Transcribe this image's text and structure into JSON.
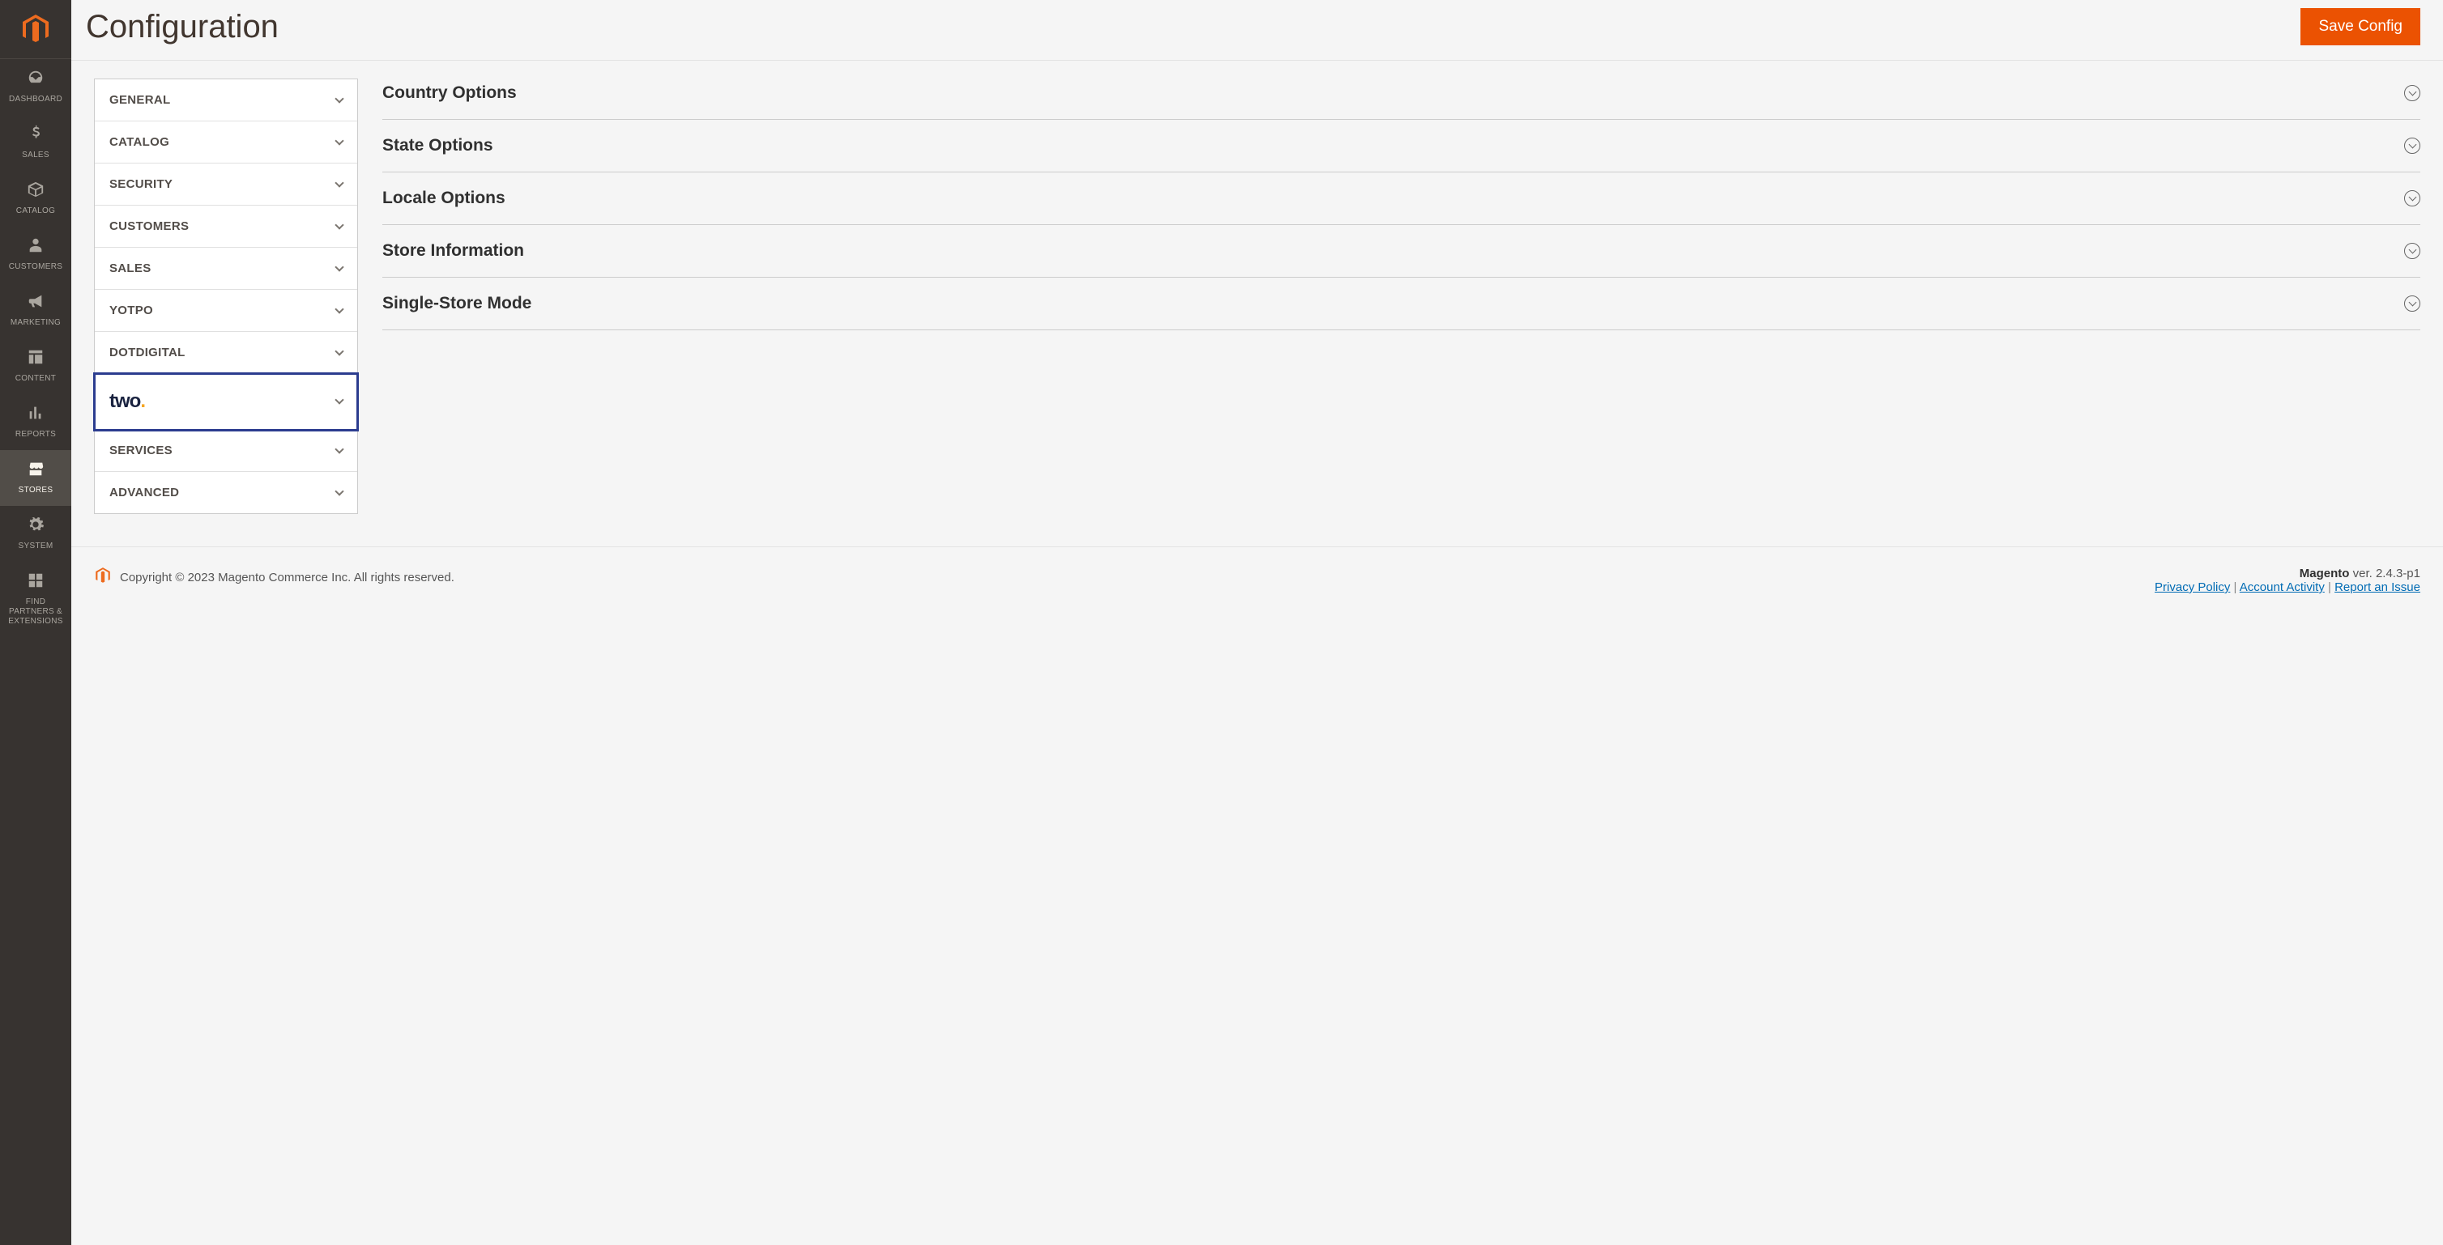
{
  "page": {
    "title": "Configuration",
    "save_label": "Save Config"
  },
  "nav": {
    "items": [
      {
        "key": "dashboard",
        "label": "DASHBOARD",
        "icon": "gauge"
      },
      {
        "key": "sales",
        "label": "SALES",
        "icon": "dollar"
      },
      {
        "key": "catalog",
        "label": "CATALOG",
        "icon": "box"
      },
      {
        "key": "customers",
        "label": "CUSTOMERS",
        "icon": "person"
      },
      {
        "key": "marketing",
        "label": "MARKETING",
        "icon": "megaphone"
      },
      {
        "key": "content",
        "label": "CONTENT",
        "icon": "layout"
      },
      {
        "key": "reports",
        "label": "REPORTS",
        "icon": "chart"
      },
      {
        "key": "stores",
        "label": "STORES",
        "icon": "store",
        "active": true
      },
      {
        "key": "system",
        "label": "SYSTEM",
        "icon": "gear"
      },
      {
        "key": "find_partners",
        "label": "FIND PARTNERS & EXTENSIONS",
        "icon": "blocks"
      }
    ]
  },
  "config_tabs": [
    {
      "key": "general",
      "label": "GENERAL"
    },
    {
      "key": "catalog",
      "label": "CATALOG"
    },
    {
      "key": "security",
      "label": "SECURITY"
    },
    {
      "key": "customers",
      "label": "CUSTOMERS"
    },
    {
      "key": "sales",
      "label": "SALES"
    },
    {
      "key": "yotpo",
      "label": "YOTPO"
    },
    {
      "key": "dotdigital",
      "label": "DOTDIGITAL"
    },
    {
      "key": "two",
      "label": "two",
      "logo": true,
      "highlighted": true
    },
    {
      "key": "services",
      "label": "SERVICES"
    },
    {
      "key": "advanced",
      "label": "ADVANCED"
    }
  ],
  "sections": [
    {
      "key": "country",
      "title": "Country Options"
    },
    {
      "key": "state",
      "title": "State Options"
    },
    {
      "key": "locale",
      "title": "Locale Options"
    },
    {
      "key": "store_info",
      "title": "Store Information"
    },
    {
      "key": "single_store",
      "title": "Single-Store Mode"
    }
  ],
  "footer": {
    "copyright": "Copyright © 2023 Magento Commerce Inc. All rights reserved.",
    "version_label": "Magento",
    "version": "ver. 2.4.3-p1",
    "links": {
      "privacy": "Privacy Policy",
      "account": "Account Activity",
      "report": "Report an Issue"
    }
  }
}
